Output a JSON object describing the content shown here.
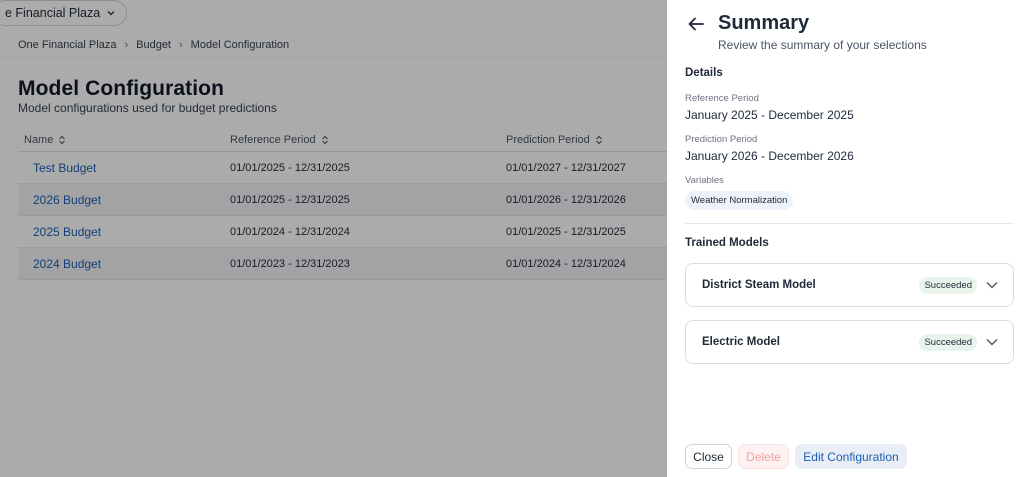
{
  "header": {
    "site_selector": "e Financial Plaza"
  },
  "breadcrumb": [
    "One Financial Plaza",
    "Budget",
    "Model Configuration"
  ],
  "page": {
    "title": "Model Configuration",
    "subtitle": "Model configurations used for budget predictions"
  },
  "table": {
    "columns": [
      "Name",
      "Reference Period",
      "Prediction Period"
    ],
    "rows": [
      {
        "name": "Test Budget",
        "reference": "01/01/2025 - 12/31/2025",
        "prediction": "01/01/2027 - 12/31/2027"
      },
      {
        "name": "2026 Budget",
        "reference": "01/01/2025 - 12/31/2025",
        "prediction": "01/01/2026 - 12/31/2026"
      },
      {
        "name": "2025 Budget",
        "reference": "01/01/2024 - 12/31/2024",
        "prediction": "01/01/2025 - 12/31/2025"
      },
      {
        "name": "2024 Budget",
        "reference": "01/01/2023 - 12/31/2023",
        "prediction": "01/01/2024 - 12/31/2024"
      }
    ]
  },
  "drawer": {
    "title": "Summary",
    "subtitle": "Review the summary of your selections",
    "details_heading": "Details",
    "reference_label": "Reference Period",
    "reference_value": "January 2025 - December 2025",
    "prediction_label": "Prediction Period",
    "prediction_value": "January 2026 - December 2026",
    "variables_label": "Variables",
    "variables": [
      "Weather Normalization"
    ],
    "trained_heading": "Trained Models",
    "models": [
      {
        "name": "District Steam Model",
        "status": "Succeeded"
      },
      {
        "name": "Electric Model",
        "status": "Succeeded"
      }
    ],
    "buttons": {
      "close": "Close",
      "delete": "Delete",
      "edit": "Edit Configuration"
    }
  },
  "icons": {
    "back": "arrow-left-icon",
    "sort": "sort-icon",
    "chevron": "chevron-down-icon"
  },
  "colors": {
    "link": "#1d5fb4",
    "success_badge_bg": "#e8f3ec",
    "delete_text": "#f3a3a3"
  }
}
